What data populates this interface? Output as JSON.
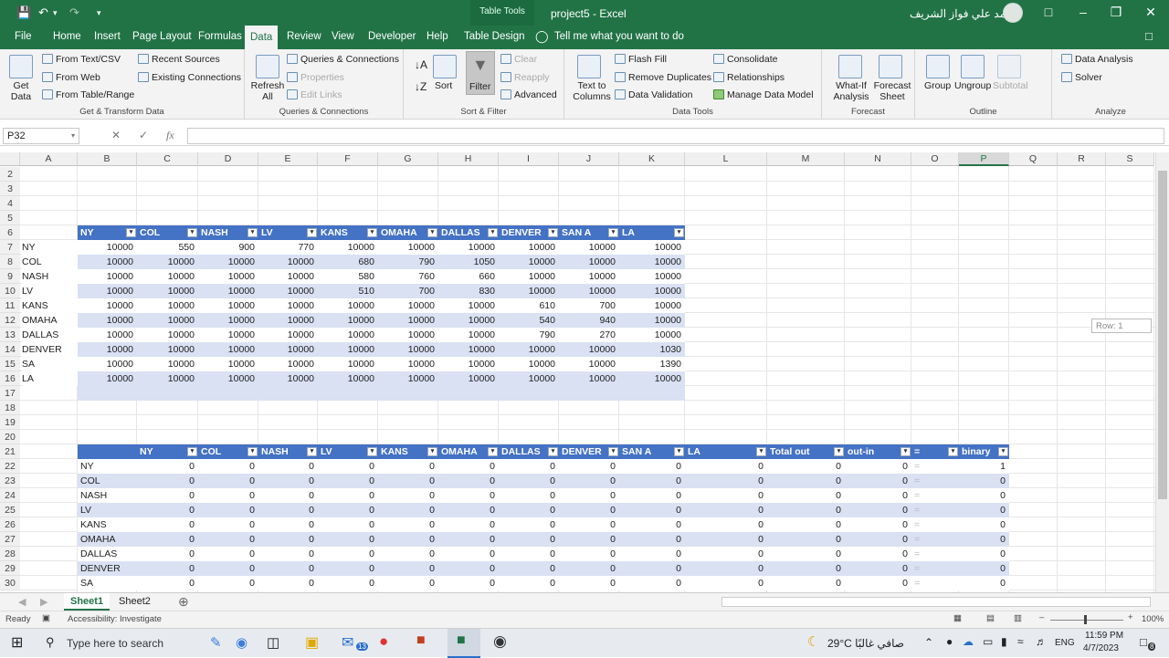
{
  "title_bar": {
    "table_tools": "Table Tools",
    "file_title": "project5  -  Excel",
    "user_name": "أحمد علي فواز الشريف"
  },
  "tabs": [
    "File",
    "Home",
    "Insert",
    "Page Layout",
    "Formulas",
    "Data",
    "Review",
    "View",
    "Developer",
    "Help",
    "Table Design"
  ],
  "active_tab": "Data",
  "tell_me": "Tell me what you want to do",
  "ribbon": {
    "get_data": "Get Data",
    "from_text": "From Text/CSV",
    "from_web": "From Web",
    "from_table": "From Table/Range",
    "recent_sources": "Recent Sources",
    "existing_connections": "Existing Connections",
    "group_get_transform": "Get & Transform Data",
    "refresh_all": "Refresh All",
    "queries_connections": "Queries & Connections",
    "properties": "Properties",
    "edit_links": "Edit Links",
    "group_queries": "Queries & Connections",
    "sort": "Sort",
    "filter": "Filter",
    "clear": "Clear",
    "reapply": "Reapply",
    "advanced": "Advanced",
    "group_sort": "Sort & Filter",
    "text_to_columns": "Text to Columns",
    "flash_fill": "Flash Fill",
    "remove_duplicates": "Remove Duplicates",
    "data_validation": "Data Validation",
    "consolidate": "Consolidate",
    "relationships": "Relationships",
    "manage_model": "Manage Data Model",
    "group_tools": "Data Tools",
    "what_if": "What-If Analysis",
    "forecast_sheet": "Forecast Sheet",
    "group_forecast": "Forecast",
    "group_btn": "Group",
    "ungroup": "Ungroup",
    "subtotal": "Subtotal",
    "group_outline": "Outline",
    "data_analysis": "Data Analysis",
    "solver": "Solver",
    "group_analyze": "Analyze"
  },
  "name_box": "P32",
  "columns": [
    "A",
    "B",
    "C",
    "D",
    "E",
    "F",
    "G",
    "H",
    "I",
    "J",
    "K",
    "L",
    "M",
    "N",
    "O",
    "P",
    "Q",
    "R",
    "S"
  ],
  "rows": [
    "2",
    "3",
    "4",
    "5",
    "6",
    "7",
    "8",
    "9",
    "10",
    "11",
    "12",
    "13",
    "14",
    "15",
    "16",
    "17",
    "18",
    "19",
    "20",
    "21",
    "22",
    "23",
    "24",
    "25",
    "26",
    "27",
    "28",
    "29",
    "30"
  ],
  "table1": {
    "headers": [
      "NY",
      "COL",
      "NASH",
      "LV",
      "KANS",
      "OMAHA",
      "DALLAS",
      "DENVER",
      "SAN A",
      "LA"
    ],
    "rows": [
      {
        "label": "NY",
        "values": [
          "10000",
          "550",
          "900",
          "770",
          "10000",
          "10000",
          "10000",
          "10000",
          "10000",
          "10000"
        ]
      },
      {
        "label": "COL",
        "values": [
          "10000",
          "10000",
          "10000",
          "10000",
          "680",
          "790",
          "1050",
          "10000",
          "10000",
          "10000"
        ]
      },
      {
        "label": "NASH",
        "values": [
          "10000",
          "10000",
          "10000",
          "10000",
          "580",
          "760",
          "660",
          "10000",
          "10000",
          "10000"
        ]
      },
      {
        "label": "LV",
        "values": [
          "10000",
          "10000",
          "10000",
          "10000",
          "510",
          "700",
          "830",
          "10000",
          "10000",
          "10000"
        ]
      },
      {
        "label": "KANS",
        "values": [
          "10000",
          "10000",
          "10000",
          "10000",
          "10000",
          "10000",
          "10000",
          "610",
          "700",
          "10000"
        ]
      },
      {
        "label": "OMAHA",
        "values": [
          "10000",
          "10000",
          "10000",
          "10000",
          "10000",
          "10000",
          "10000",
          "540",
          "940",
          "10000"
        ]
      },
      {
        "label": "DALLAS",
        "values": [
          "10000",
          "10000",
          "10000",
          "10000",
          "10000",
          "10000",
          "10000",
          "790",
          "270",
          "10000"
        ]
      },
      {
        "label": "DENVER",
        "values": [
          "10000",
          "10000",
          "10000",
          "10000",
          "10000",
          "10000",
          "10000",
          "10000",
          "10000",
          "1030"
        ]
      },
      {
        "label": "SA",
        "values": [
          "10000",
          "10000",
          "10000",
          "10000",
          "10000",
          "10000",
          "10000",
          "10000",
          "10000",
          "1390"
        ]
      },
      {
        "label": "LA",
        "values": [
          "10000",
          "10000",
          "10000",
          "10000",
          "10000",
          "10000",
          "10000",
          "10000",
          "10000",
          "10000"
        ]
      }
    ]
  },
  "table2": {
    "headers": [
      "NY",
      "COL",
      "NASH",
      "LV",
      "KANS",
      "OMAHA",
      "DALLAS",
      "DENVER",
      "SAN A",
      "LA",
      "Total out",
      "out-in",
      "=",
      "binary"
    ],
    "rows": [
      {
        "label": "NY",
        "values": [
          "0",
          "0",
          "0",
          "0",
          "0",
          "0",
          "0",
          "0",
          "0",
          "0",
          "0",
          "0",
          "=",
          "1"
        ]
      },
      {
        "label": "COL",
        "values": [
          "0",
          "0",
          "0",
          "0",
          "0",
          "0",
          "0",
          "0",
          "0",
          "0",
          "0",
          "0",
          "=",
          "0"
        ]
      },
      {
        "label": "NASH",
        "values": [
          "0",
          "0",
          "0",
          "0",
          "0",
          "0",
          "0",
          "0",
          "0",
          "0",
          "0",
          "0",
          "=",
          "0"
        ]
      },
      {
        "label": "LV",
        "values": [
          "0",
          "0",
          "0",
          "0",
          "0",
          "0",
          "0",
          "0",
          "0",
          "0",
          "0",
          "0",
          "=",
          "0"
        ]
      },
      {
        "label": "KANS",
        "values": [
          "0",
          "0",
          "0",
          "0",
          "0",
          "0",
          "0",
          "0",
          "0",
          "0",
          "0",
          "0",
          "=",
          "0"
        ]
      },
      {
        "label": "OMAHA",
        "values": [
          "0",
          "0",
          "0",
          "0",
          "0",
          "0",
          "0",
          "0",
          "0",
          "0",
          "0",
          "0",
          "=",
          "0"
        ]
      },
      {
        "label": "DALLAS",
        "values": [
          "0",
          "0",
          "0",
          "0",
          "0",
          "0",
          "0",
          "0",
          "0",
          "0",
          "0",
          "0",
          "=",
          "0"
        ]
      },
      {
        "label": "DENVER",
        "values": [
          "0",
          "0",
          "0",
          "0",
          "0",
          "0",
          "0",
          "0",
          "0",
          "0",
          "0",
          "0",
          "=",
          "0"
        ]
      },
      {
        "label": "SA",
        "values": [
          "0",
          "0",
          "0",
          "0",
          "0",
          "0",
          "0",
          "0",
          "0",
          "0",
          "0",
          "0",
          "=",
          "0"
        ]
      }
    ]
  },
  "tooltip": "Row: 1",
  "sheets": [
    "Sheet1",
    "Sheet2"
  ],
  "active_sheet": "Sheet1",
  "status": {
    "ready": "Ready",
    "accessibility": "Accessibility: Investigate",
    "zoom": "100%"
  },
  "taskbar": {
    "search": "Type here to search",
    "weather": "29°C  صافي غالبًا",
    "lang": "ENG",
    "time": "11:59 PM",
    "date": "4/7/2023",
    "mail_badge": "13",
    "notif_badge": "8"
  },
  "colors": {
    "excel_green": "#217346",
    "table_header": "#4472c4",
    "band": "#d9e1f2"
  }
}
